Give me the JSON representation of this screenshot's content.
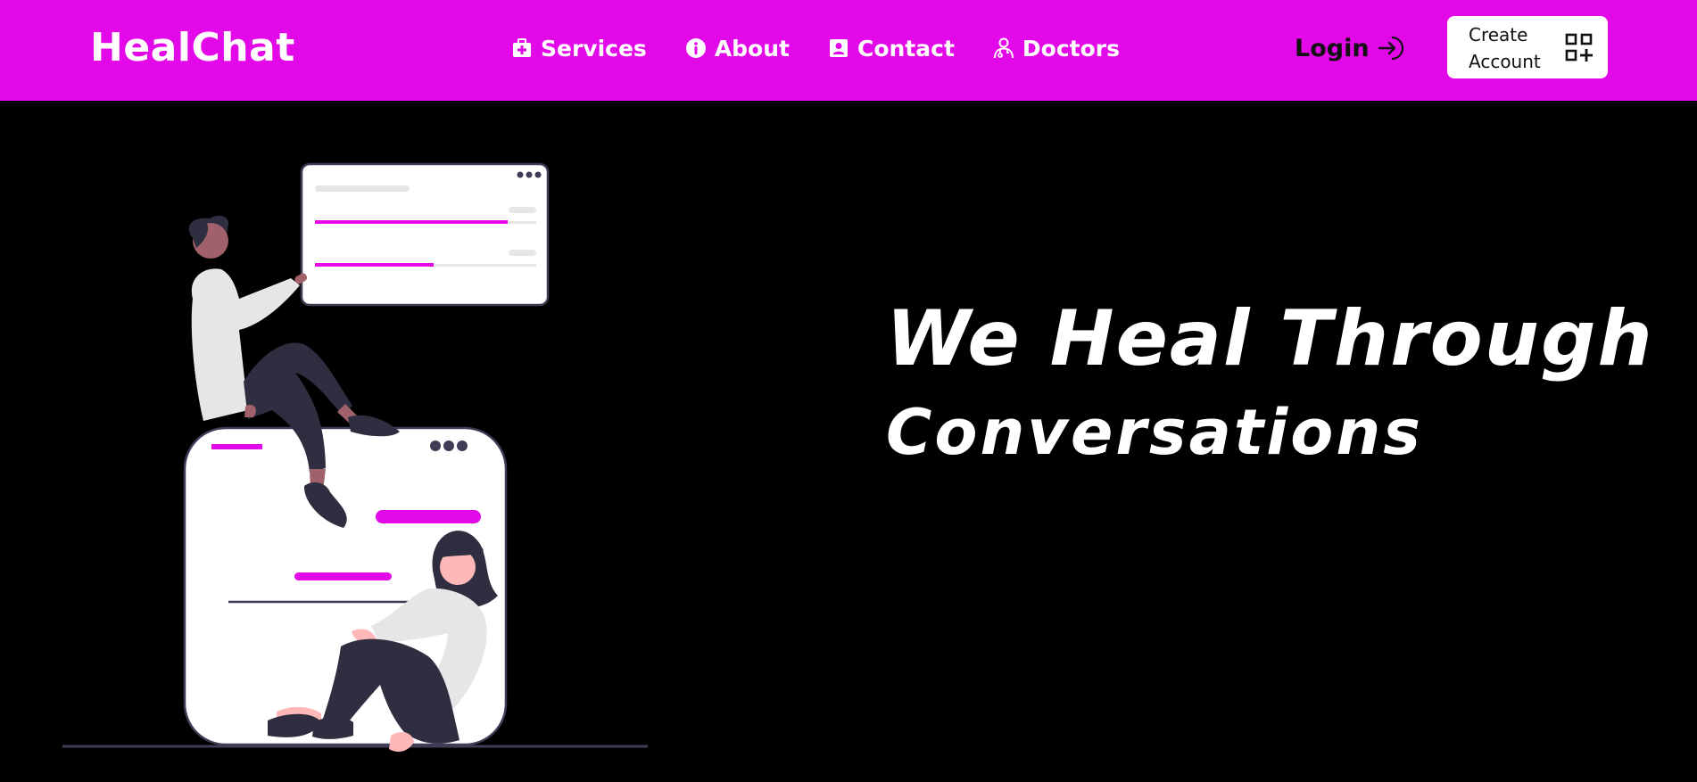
{
  "header": {
    "brand": "HealChat",
    "nav": [
      {
        "label": "Services",
        "icon": "medical-kit-icon"
      },
      {
        "label": "About",
        "icon": "info-icon"
      },
      {
        "label": "Contact",
        "icon": "contact-card-icon"
      },
      {
        "label": "Doctors",
        "icon": "doctor-icon"
      }
    ],
    "login_label": "Login",
    "login_icon": "login-arrow-icon",
    "create_account_label": "Create\nAccount",
    "create_account_icon": "grid-add-icon"
  },
  "hero": {
    "headline_line1": "We Heal Through",
    "headline_line2": "Conversations"
  },
  "colors": {
    "accent": "#e308e8",
    "background": "#000000",
    "text_light": "#ffffff",
    "text_dark": "#111111"
  }
}
